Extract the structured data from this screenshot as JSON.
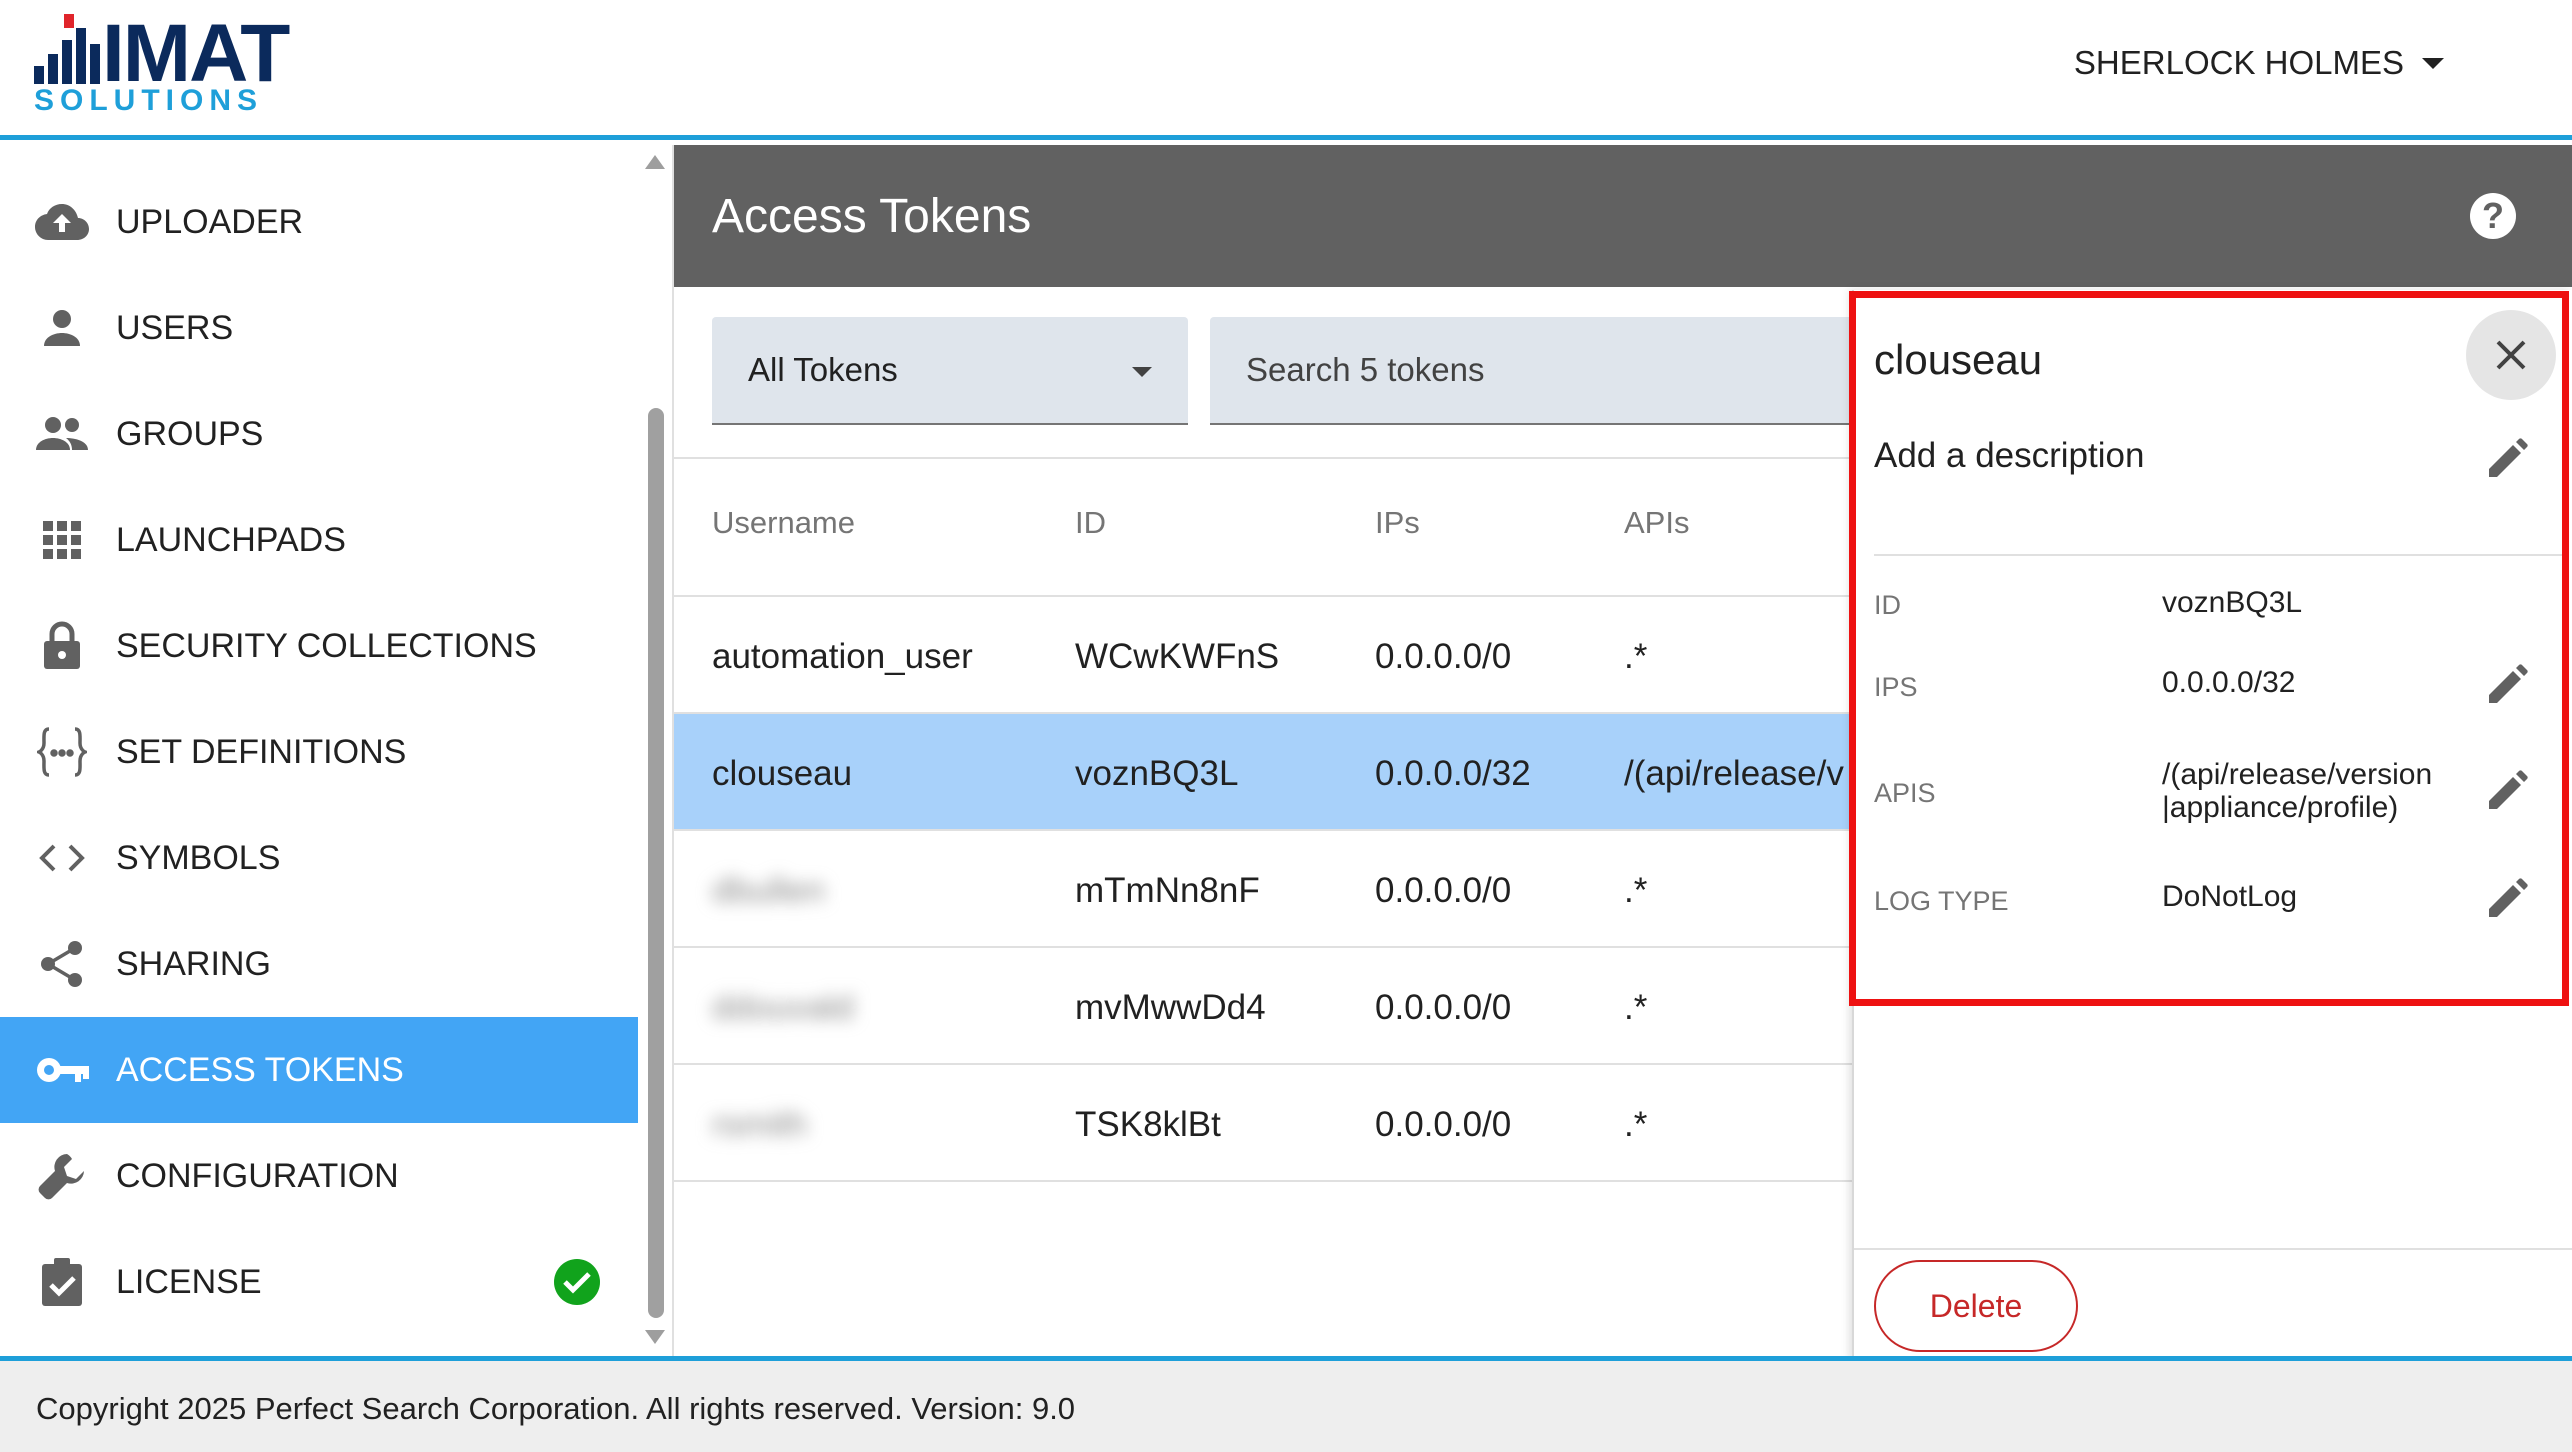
{
  "brand": {
    "logo_main": "IMAT",
    "logo_sub": "SOLUTIONS",
    "colors": {
      "navy": "#0b2a5c",
      "blue": "#1e9fd9",
      "red": "#e0252b"
    }
  },
  "header": {
    "user_name": "SHERLOCK HOLMES"
  },
  "sidebar": {
    "items": [
      {
        "label": "UPLOADER",
        "icon": "cloud-upload-icon"
      },
      {
        "label": "USERS",
        "icon": "person-icon"
      },
      {
        "label": "GROUPS",
        "icon": "people-icon"
      },
      {
        "label": "LAUNCHPADS",
        "icon": "grid-icon"
      },
      {
        "label": "SECURITY COLLECTIONS",
        "icon": "lock-icon"
      },
      {
        "label": "SET DEFINITIONS",
        "icon": "braces-icon"
      },
      {
        "label": "SYMBOLS",
        "icon": "code-icon"
      },
      {
        "label": "SHARING",
        "icon": "share-icon"
      },
      {
        "label": "ACCESS TOKENS",
        "icon": "key-icon",
        "active": true
      },
      {
        "label": "CONFIGURATION",
        "icon": "wrench-icon"
      },
      {
        "label": "LICENSE",
        "icon": "clipboard-check-icon",
        "status": "check-circle-icon"
      }
    ]
  },
  "page": {
    "title": "Access Tokens",
    "filter_value": "All Tokens",
    "search_placeholder": "Search 5 tokens"
  },
  "table": {
    "columns": [
      "Username",
      "ID",
      "IPs",
      "APIs"
    ],
    "rows": [
      {
        "username": "automation_user",
        "id": "WCwKWFnS",
        "ips": "0.0.0.0/0",
        "apis": ".*"
      },
      {
        "username": "clouseau",
        "id": "voznBQ3L",
        "ips": "0.0.0.0/32",
        "apis": "/(api/release/v",
        "selected": true
      },
      {
        "username": "dbullen",
        "id": "mTmNn8nF",
        "ips": "0.0.0.0/0",
        "apis": ".*",
        "blurred": true
      },
      {
        "username": "ddouvald",
        "id": "mvMwwDd4",
        "ips": "0.0.0.0/0",
        "apis": ".*",
        "blurred": true
      },
      {
        "username": "rsmith",
        "id": "TSK8klBt",
        "ips": "0.0.0.0/0",
        "apis": ".*",
        "blurred": true
      }
    ]
  },
  "detail": {
    "name": "clouseau",
    "description_placeholder": "Add a description",
    "fields": [
      {
        "label": "ID",
        "value": "voznBQ3L",
        "editable": false
      },
      {
        "label": "IPS",
        "value": "0.0.0.0/32",
        "editable": true
      },
      {
        "label": "APIS",
        "value_line1": "/(api/release/version",
        "value_line2": "|appliance/profile)",
        "editable": true
      },
      {
        "label": "LOG TYPE",
        "value": "DoNotLog",
        "editable": true
      }
    ],
    "delete_label": "Delete"
  },
  "footer": {
    "text": "Copyright 2025 Perfect Search Corporation. All rights reserved. Version: 9.0"
  }
}
